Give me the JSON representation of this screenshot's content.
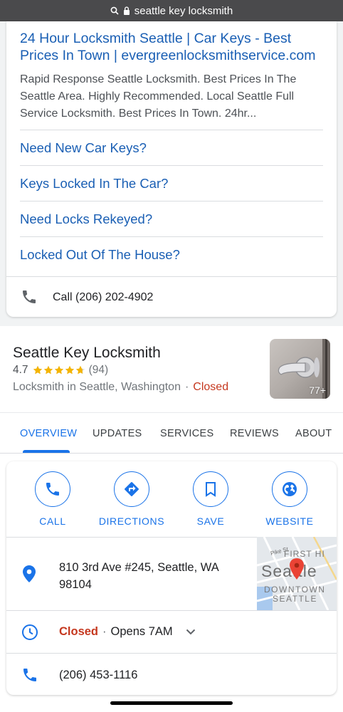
{
  "browser": {
    "query": "seattle key locksmith"
  },
  "ad": {
    "title": "24 Hour Locksmith Seattle | Car Keys - Best Prices In Town | evergreenlocksmithservice.com",
    "description": "Rapid Response Seattle Locksmith. Best Prices In The Seattle Area. Highly Recommended. Local Seattle Full Service Locksmith. Best Prices In Town. 24hr...",
    "sitelinks": [
      "Need New Car Keys?",
      "Keys Locked In The Car?",
      "Need Locks Rekeyed?",
      "Locked Out Of The House?"
    ],
    "call_label": "Call (206) 202-4902"
  },
  "business": {
    "name": "Seattle Key Locksmith",
    "rating": "4.7",
    "rating_fraction": 0.94,
    "review_count": "(94)",
    "category": "Locksmith in Seattle, Washington",
    "separator": "·",
    "status": "Closed",
    "photo_count": "77+",
    "tabs": [
      "OVERVIEW",
      "UPDATES",
      "SERVICES",
      "REVIEWS",
      "ABOUT"
    ],
    "actions": [
      {
        "label": "CALL",
        "icon": "phone-icon"
      },
      {
        "label": "DIRECTIONS",
        "icon": "directions-icon"
      },
      {
        "label": "SAVE",
        "icon": "bookmark-icon"
      },
      {
        "label": "WEBSITE",
        "icon": "globe-icon"
      }
    ],
    "address": "810 3rd Ave #245, Seattle, WA 98104",
    "hours_status": "Closed",
    "hours_separator": "·",
    "hours_next": "Opens 7AM",
    "phone": "(206) 453-1116",
    "map_labels": {
      "street": "Pike St",
      "district1": "FIRST HI",
      "city": "Seattle",
      "district2": "DOWNTOWN",
      "district3": "SEATTLE"
    }
  },
  "colors": {
    "link": "#1a5fb4",
    "accent": "#1a73e8",
    "closed": "#c5381f",
    "star": "#f4b400"
  }
}
